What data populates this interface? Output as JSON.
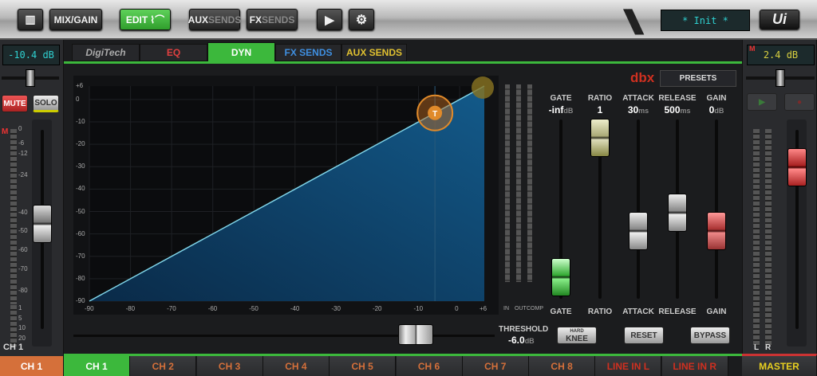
{
  "toolbar": {
    "mix_gain": "MIX/GAIN",
    "edit": "EDIT",
    "aux_a": "AUX",
    "aux_b": "SENDS",
    "fx_a": "FX",
    "fx_b": "SENDS",
    "snapshot": "* Init *",
    "logo": "Ui",
    "icons": [
      "meters-icon",
      "play-icon",
      "gear-icon"
    ]
  },
  "left_strip": {
    "level": "-10.4 dB",
    "mute": "MUTE",
    "solo": "SOLO",
    "m": "M",
    "name": "CH 1",
    "scale": [
      "0",
      "-6",
      "-12",
      "-24",
      "-40",
      "-50",
      "-60",
      "-70",
      "-80"
    ],
    "scale2": [
      "1",
      "5",
      "10",
      "20"
    ],
    "fader_db": -50
  },
  "right_strip": {
    "level": "2.4 dB",
    "m": "M",
    "l": "L",
    "r": "R",
    "fader_db": 2.4
  },
  "tabs": {
    "brand": "DigiTech",
    "items": [
      {
        "label": "EQ",
        "color": "#e04040"
      },
      {
        "label": "DYN",
        "color": "#ffffff",
        "active": true
      },
      {
        "label": "FX SENDS",
        "color": "#3f8fe0"
      },
      {
        "label": "AUX SENDS",
        "color": "#e0c030"
      }
    ]
  },
  "graph": {
    "y_ticks": [
      "+6",
      "0",
      "-10",
      "-20",
      "-30",
      "-40",
      "-50",
      "-60",
      "-70",
      "-80",
      "-90"
    ],
    "x_ticks": [
      "-90",
      "-80",
      "-70",
      "-60",
      "-50",
      "-40",
      "-30",
      "-20",
      "-10",
      "0",
      "+6"
    ],
    "threshold_marker": "T",
    "meters": [
      "IN",
      "OUT",
      "COMP"
    ],
    "threshold_label": "THRESHOLD",
    "threshold_value": "-6.0",
    "threshold_unit": "dB",
    "threshold_db": -6
  },
  "dynamics": {
    "brand": "dbx",
    "presets": "PRESETS",
    "params": [
      {
        "name": "GATE",
        "value": "-inf",
        "unit": "dB",
        "pos": 0.88,
        "color": "green"
      },
      {
        "name": "RATIO",
        "value": "1",
        "unit": "",
        "pos": 0.1,
        "color": "yellow"
      },
      {
        "name": "ATTACK",
        "value": "30",
        "unit": "ms",
        "pos": 0.62,
        "color": "white"
      },
      {
        "name": "RELEASE",
        "value": "500",
        "unit": "ms",
        "pos": 0.52,
        "color": "white"
      },
      {
        "name": "GAIN",
        "value": "0",
        "unit": "dB",
        "pos": 0.62,
        "color": "red"
      }
    ],
    "hard": "HARD",
    "knee": "KNEE",
    "reset": "RESET",
    "bypass": "BYPASS"
  },
  "channels": {
    "current": "CH 1",
    "items": [
      "CH 1",
      "CH 2",
      "CH 3",
      "CH 4",
      "CH 5",
      "CH 6",
      "CH 7",
      "CH 8",
      "LINE IN L",
      "LINE IN R"
    ],
    "master": "MASTER"
  }
}
